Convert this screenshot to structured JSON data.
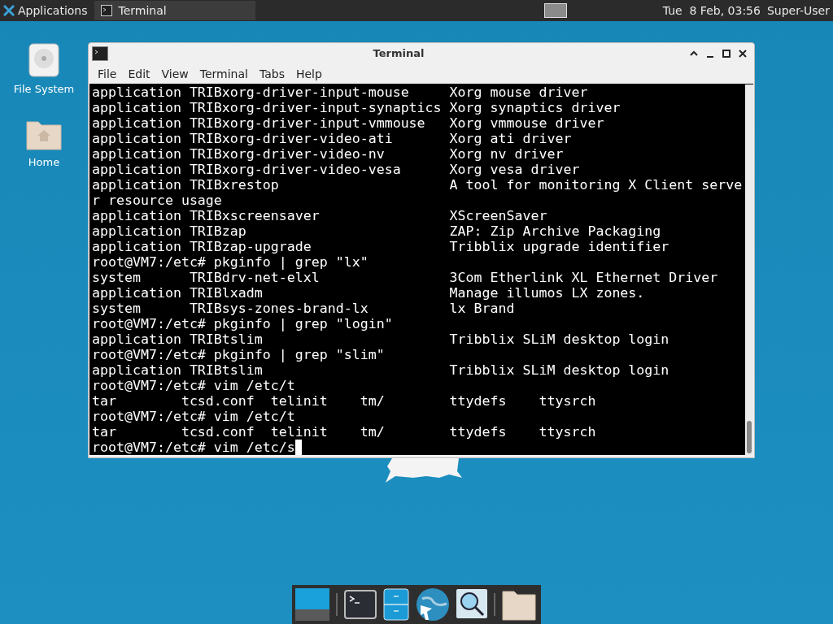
{
  "top_panel": {
    "menu_label": "Applications",
    "tasks": [
      {
        "label": "Terminal",
        "selected": true
      }
    ],
    "clock": "Tue  8 Feb, 03:56",
    "user": "Super-User"
  },
  "desktop_icons": [
    {
      "label": "File System",
      "kind": "drive"
    },
    {
      "label": "Home",
      "kind": "folder"
    }
  ],
  "window": {
    "title": "Terminal",
    "menu": [
      "File",
      "Edit",
      "View",
      "Terminal",
      "Tabs",
      "Help"
    ],
    "lines": [
      "application TRIBxorg-driver-input-mouse     Xorg mouse driver",
      "application TRIBxorg-driver-input-synaptics Xorg synaptics driver",
      "application TRIBxorg-driver-input-vmmouse   Xorg vmmouse driver",
      "application TRIBxorg-driver-video-ati       Xorg ati driver",
      "application TRIBxorg-driver-video-nv        Xorg nv driver",
      "application TRIBxorg-driver-video-vesa      Xorg vesa driver",
      "application TRIBxrestop                     A tool for monitoring X Client serve",
      "r resource usage",
      "application TRIBxscreensaver                XScreenSaver",
      "application TRIBzap                         ZAP: Zip Archive Packaging",
      "application TRIBzap-upgrade                 Tribblix upgrade identifier",
      "root@VM7:/etc# pkginfo | grep \"lx\"",
      "system      TRIBdrv-net-elxl                3Com Etherlink XL Ethernet Driver",
      "application TRIBlxadm                       Manage illumos LX zones.",
      "system      TRIBsys-zones-brand-lx          lx Brand",
      "root@VM7:/etc# pkginfo | grep \"login\"",
      "application TRIBtslim                       Tribblix SLiM desktop login",
      "root@VM7:/etc# pkginfo | grep \"slim\"",
      "application TRIBtslim                       Tribblix SLiM desktop login",
      "root@VM7:/etc# vim /etc/t",
      "tar        tcsd.conf  telinit    tm/        ttydefs    ttysrch",
      "root@VM7:/etc# vim /etc/t",
      "tar        tcsd.conf  telinit    tm/        ttydefs    ttysrch",
      "root@VM7:/etc# vim /etc/s"
    ],
    "cursor": true
  }
}
